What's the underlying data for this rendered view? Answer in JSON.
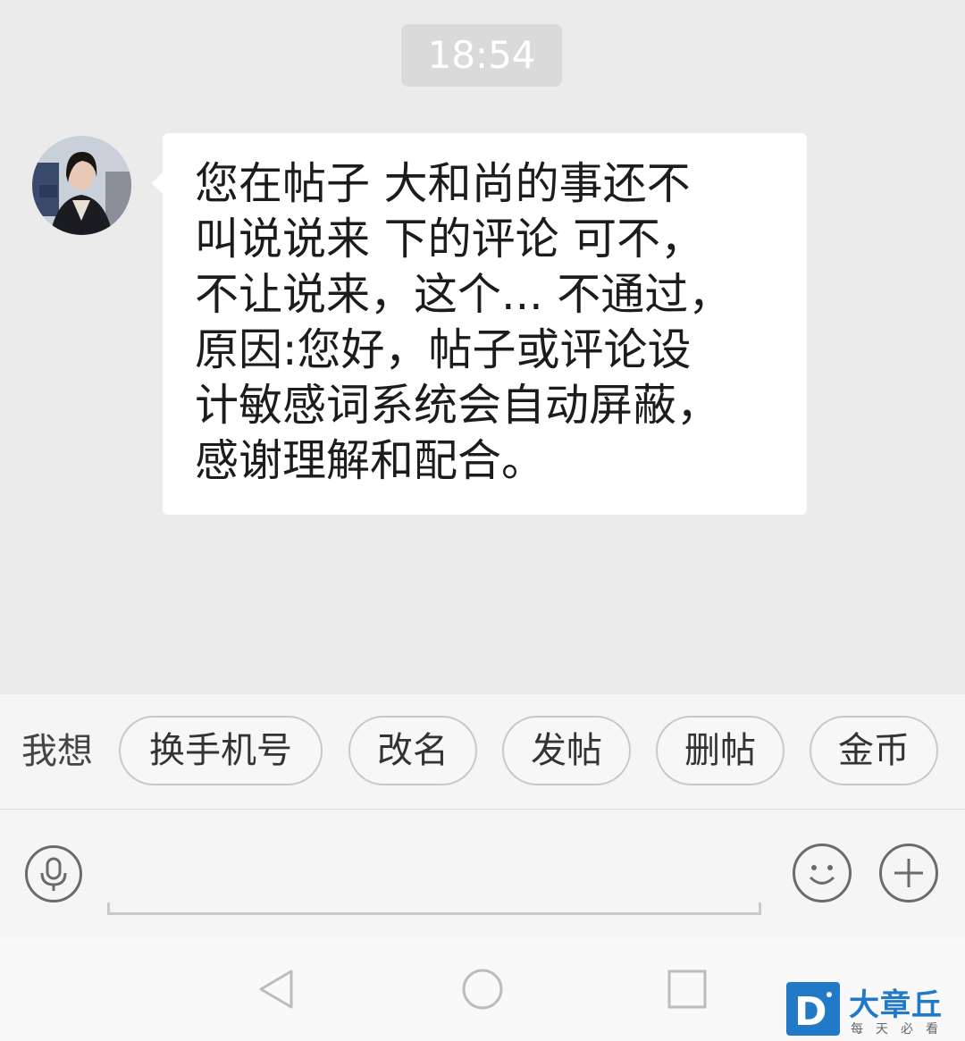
{
  "chat": {
    "timestamp": "18:54",
    "message": "您在帖子 大和尚的事还不\n叫说说来 下的评论 可不，\n不让说来，这个... 不通过，\n原因:您好，帖子或评论设\n计敏感词系统会自动屏蔽，\n感谢理解和配合。"
  },
  "quick_replies": {
    "label": "我想",
    "chips": [
      "换手机号",
      "改名",
      "发帖",
      "删帖",
      "金币"
    ]
  },
  "input_bar": {
    "icons": [
      "microphone-icon",
      "emoji-icon",
      "plus-icon"
    ]
  },
  "nav_bar": {
    "icons": [
      "back-icon",
      "home-icon",
      "recents-icon"
    ]
  },
  "watermark": {
    "title": "大章丘",
    "subtitle": "每天必看",
    "brand_color": "#2279c8"
  }
}
